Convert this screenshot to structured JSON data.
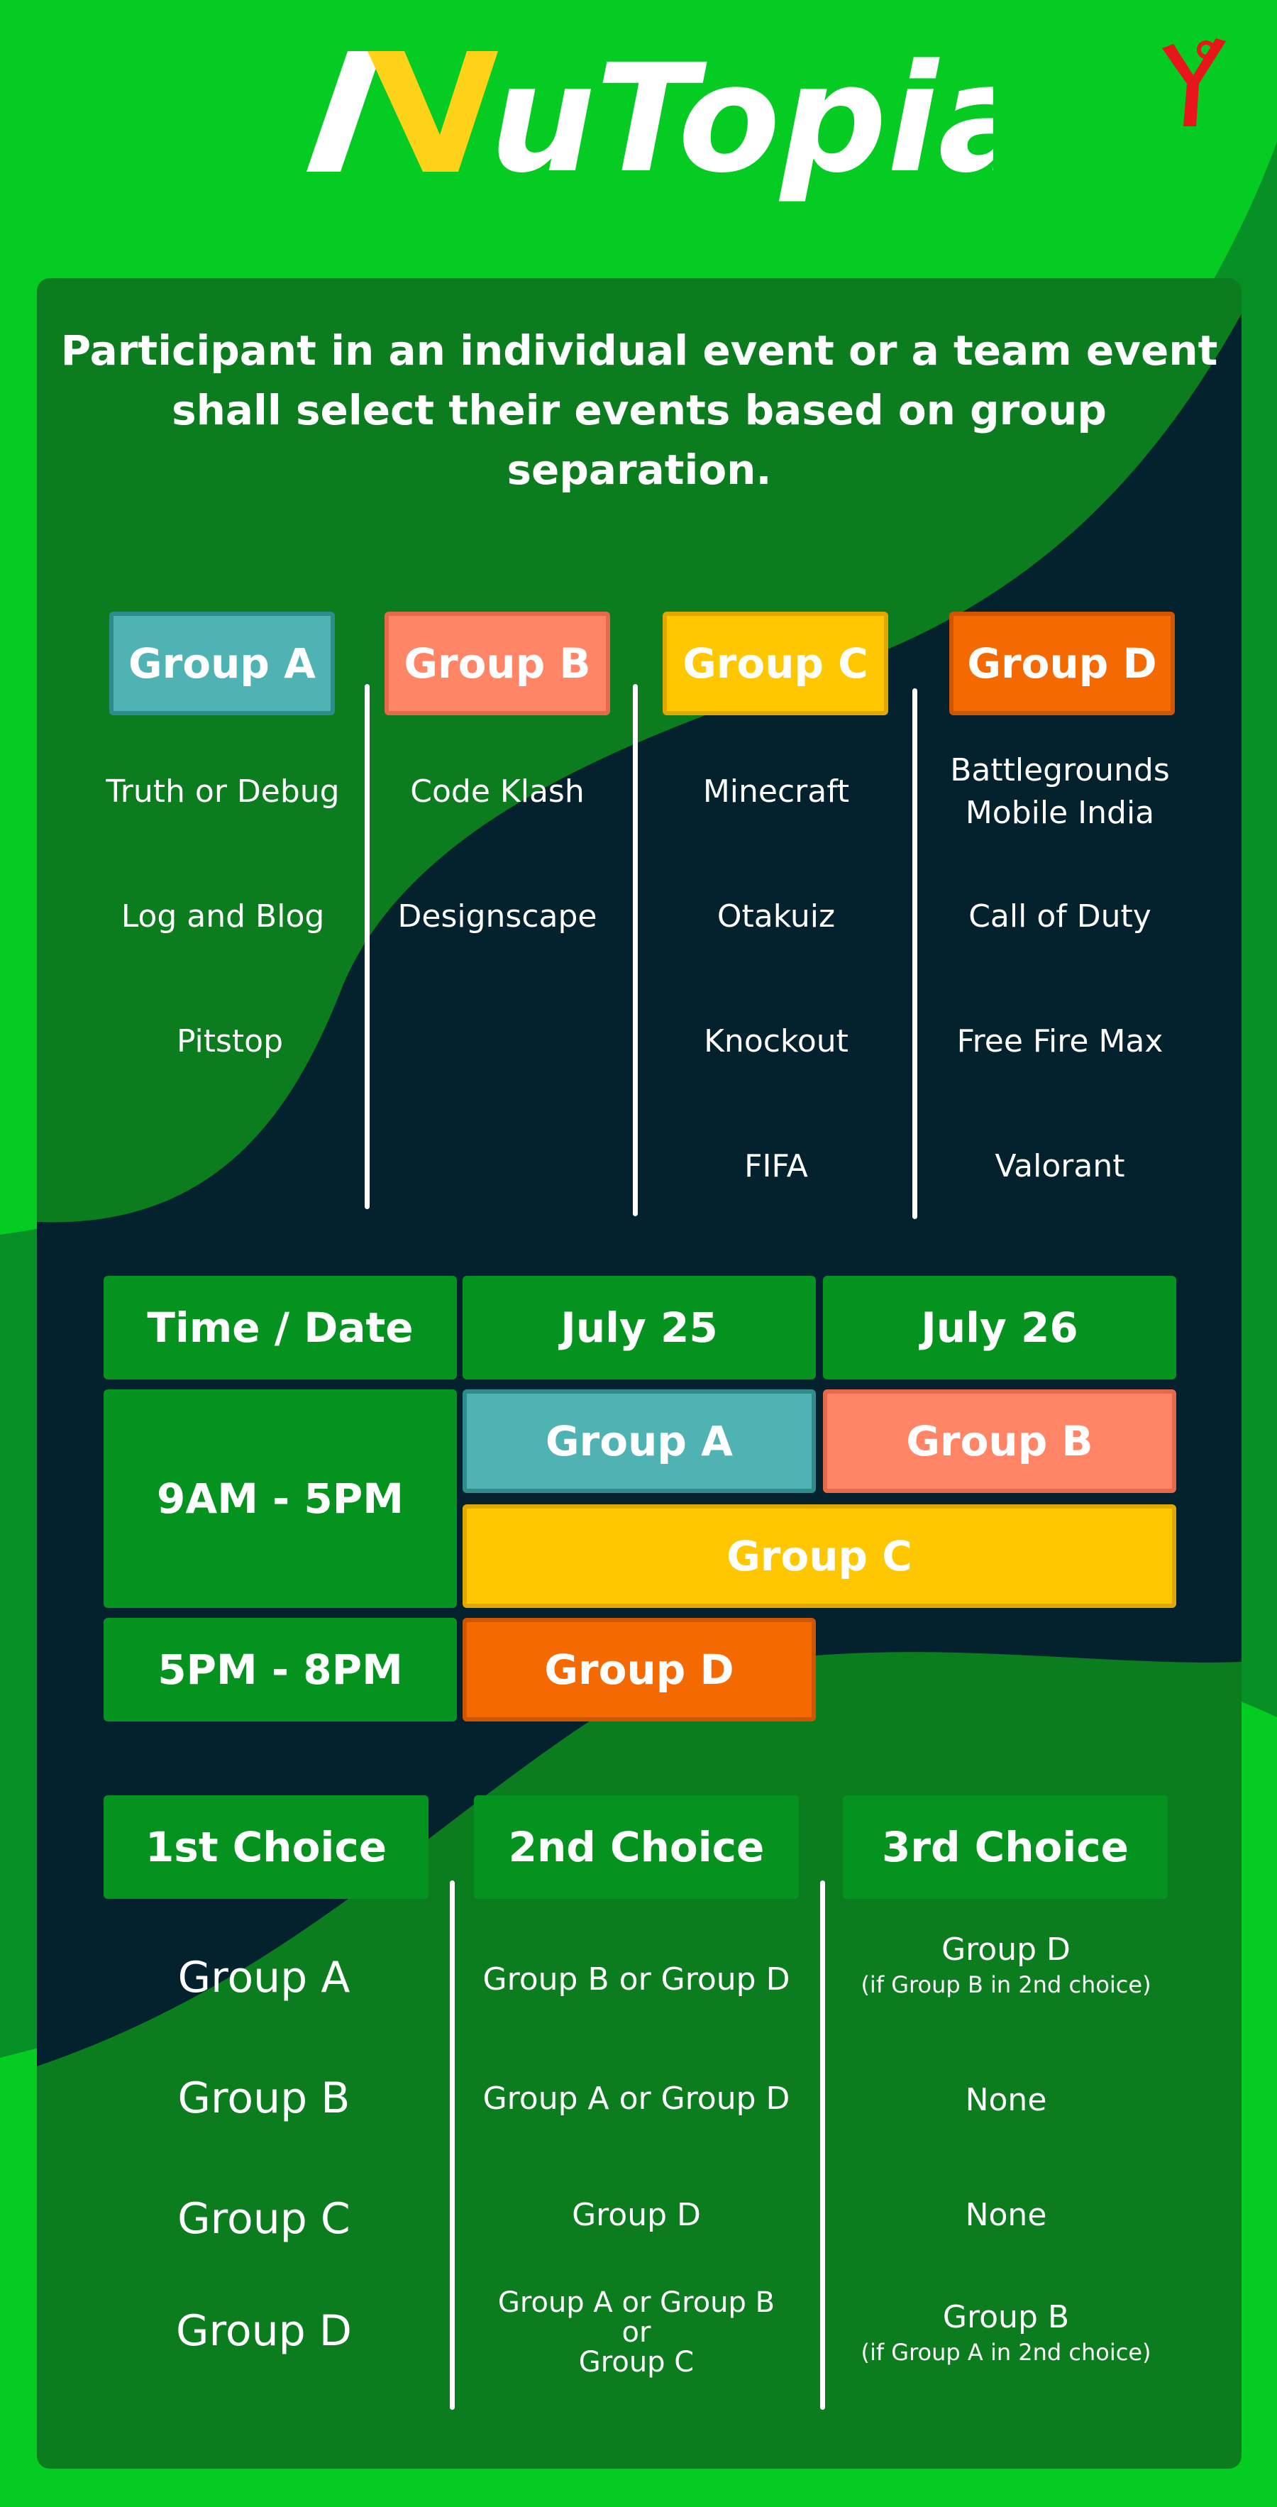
{
  "logo": {
    "text": "NuTopia",
    "letters": [
      "N",
      "uTopia"
    ]
  },
  "intro": [
    "Participant in an individual event or a team event",
    "shall select their events based on group separation."
  ],
  "colors": {
    "group_a": "#4fb3b3",
    "group_b": "#ff8566",
    "group_c": "#ffc700",
    "group_d": "#f56a00",
    "bright_green": "#04cc22",
    "panel_green": "#0b7d1f",
    "dark_navy": "#03222d"
  },
  "groups": [
    {
      "name": "Group A",
      "events": [
        "Truth or Debug",
        "Log and Blog",
        "Pitstop"
      ]
    },
    {
      "name": "Group B",
      "events": [
        "Code Klash",
        "Designscape"
      ]
    },
    {
      "name": "Group C",
      "events": [
        "Minecraft",
        "Otakuiz",
        "Knockout",
        "FIFA"
      ]
    },
    {
      "name": "Group D",
      "events": [
        "Battlegrounds\nMobile India",
        "Call of Duty",
        "Free Fire Max",
        "Valorant"
      ]
    }
  ],
  "schedule": {
    "header": [
      "Time / Date",
      "July 25",
      "July 26"
    ],
    "slot1_time": "9AM - 5PM",
    "slot2_time": "5PM - 8PM",
    "slot1_day1": "Group A",
    "slot1_day2": "Group B",
    "slot1_both": "Group C",
    "slot2_day1": "Group D"
  },
  "choices": {
    "headers": [
      "1st Choice",
      "2nd Choice",
      "3rd Choice"
    ],
    "rows": [
      {
        "first": "Group A",
        "second": "Group B or Group D",
        "third": "Group D",
        "third_note": "(if Group B in 2nd choice)"
      },
      {
        "first": "Group B",
        "second": "Group A or Group D",
        "third": "None",
        "third_note": ""
      },
      {
        "first": "Group C",
        "second": "Group D",
        "third": "None",
        "third_note": ""
      },
      {
        "first": "Group D",
        "second_lines": [
          "Group A or Group B",
          "or",
          "Group C"
        ],
        "third": "Group B",
        "third_note": "(if Group A in 2nd choice)"
      }
    ]
  }
}
